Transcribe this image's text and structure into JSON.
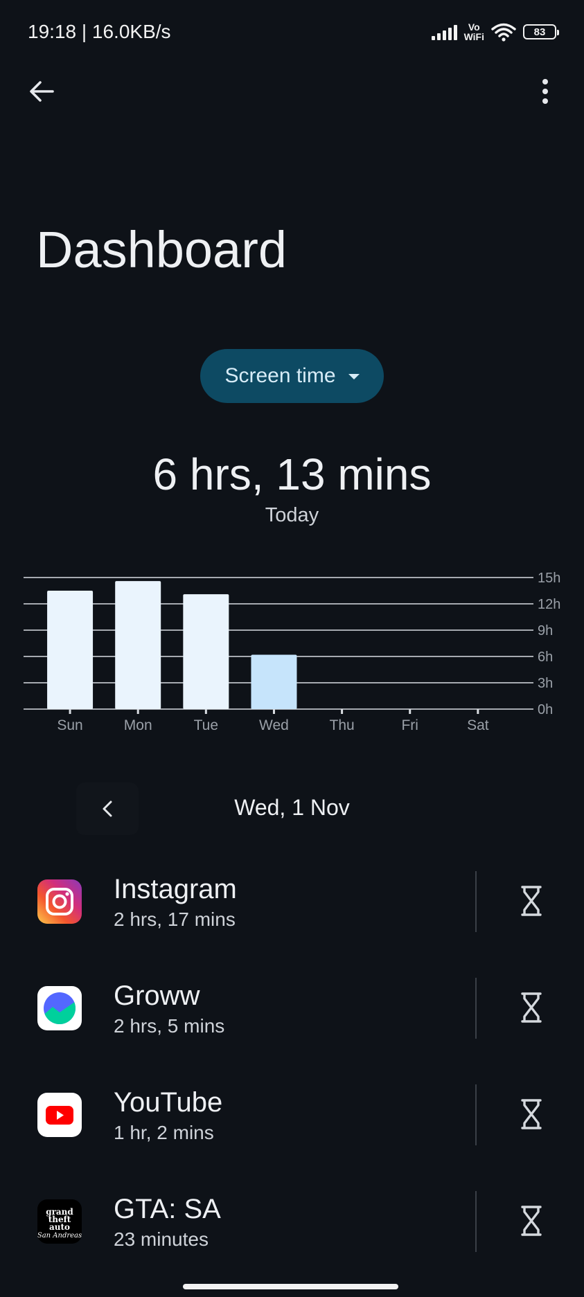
{
  "status_bar": {
    "time_speed": "19:18 | 16.0KB/s",
    "vowifi_top": "Vo",
    "vowifi_bottom": "WiFi",
    "battery": "83"
  },
  "header": {
    "back_icon": "arrow-left-icon",
    "menu_icon": "more-vert-icon"
  },
  "title": "Dashboard",
  "metric_dropdown": {
    "label": "Screen time"
  },
  "summary": {
    "total": "6 hrs, 13 mins",
    "period": "Today"
  },
  "chart_data": {
    "type": "bar",
    "categories": [
      "Sun",
      "Mon",
      "Tue",
      "Wed",
      "Thu",
      "Fri",
      "Sat"
    ],
    "values": [
      13.5,
      14.6,
      13.1,
      6.2,
      0,
      0,
      0
    ],
    "y_ticks": [
      "0h",
      "3h",
      "6h",
      "9h",
      "12h",
      "15h"
    ],
    "ylim": [
      0,
      15
    ],
    "grid": true,
    "highlighted_category": "Wed",
    "colors": {
      "bar": "#eaf4fd",
      "highlight": "#c6e4fb",
      "grid": "#d9dde2",
      "label": "#9aa0a8"
    }
  },
  "date_nav": {
    "label": "Wed, 1 Nov"
  },
  "apps": [
    {
      "name": "Instagram",
      "time": "2 hrs, 17 mins",
      "icon": "instagram-icon"
    },
    {
      "name": "Groww",
      "time": "2 hrs, 5 mins",
      "icon": "groww-icon"
    },
    {
      "name": "YouTube",
      "time": "1 hr, 2 mins",
      "icon": "youtube-icon"
    },
    {
      "name": "GTA: SA",
      "time": "23 minutes",
      "icon": "gta-sa-icon",
      "logo_text": "grand theft auto San Andreas"
    }
  ]
}
